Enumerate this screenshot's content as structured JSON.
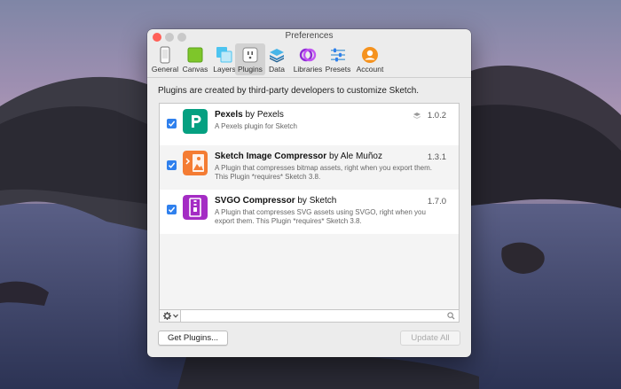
{
  "window": {
    "title": "Preferences",
    "controls": {
      "close_color": "#ff5f57",
      "min_color": "#febc2e",
      "zoom_color": "#28c840"
    }
  },
  "toolbar": {
    "items": [
      {
        "label": "General",
        "icon": "phone-icon"
      },
      {
        "label": "Canvas",
        "icon": "canvas-icon"
      },
      {
        "label": "Layers",
        "icon": "layers-icon"
      },
      {
        "label": "Plugins",
        "icon": "plugin-outlet-icon",
        "selected": true
      },
      {
        "label": "Data",
        "icon": "data-stack-icon"
      },
      {
        "label": "Libraries",
        "icon": "libraries-icon"
      },
      {
        "label": "Presets",
        "icon": "sliders-icon"
      },
      {
        "label": "Account",
        "icon": "account-icon"
      }
    ]
  },
  "intro_text": "Plugins are created by third-party developers to customize Sketch.",
  "plugins": [
    {
      "name": "Pexels",
      "by": " by Pexels",
      "description": "A Pexels plugin for Sketch",
      "version": "1.0.2",
      "enabled": true,
      "icon": "pexels-icon",
      "icon_color": "#05a081",
      "version_icon": "layers-small-icon"
    },
    {
      "name": "Sketch Image Compressor",
      "by": " by Ale Muñoz",
      "description": "A Plugin that compresses bitmap assets, right when you export them. This Plugin *requires* Sketch 3.8.",
      "version": "1.3.1",
      "enabled": true,
      "icon": "image-compressor-icon",
      "icon_color": "#f47c33"
    },
    {
      "name": "SVGO Compressor",
      "by": " by Sketch",
      "description": "A Plugin that compresses SVG assets using SVGO, right when you export them. This Plugin *requires* Sketch 3.8.",
      "version": "1.7.0",
      "enabled": true,
      "icon": "svgo-compressor-icon",
      "icon_color": "#a42cc4"
    }
  ],
  "list_footer": {
    "gear_icon": "gear-icon",
    "search_icon": "search-icon"
  },
  "buttons": {
    "get_plugins": "Get Plugins...",
    "update_all": "Update All"
  },
  "colors": {
    "accent": "#2f80ed"
  }
}
